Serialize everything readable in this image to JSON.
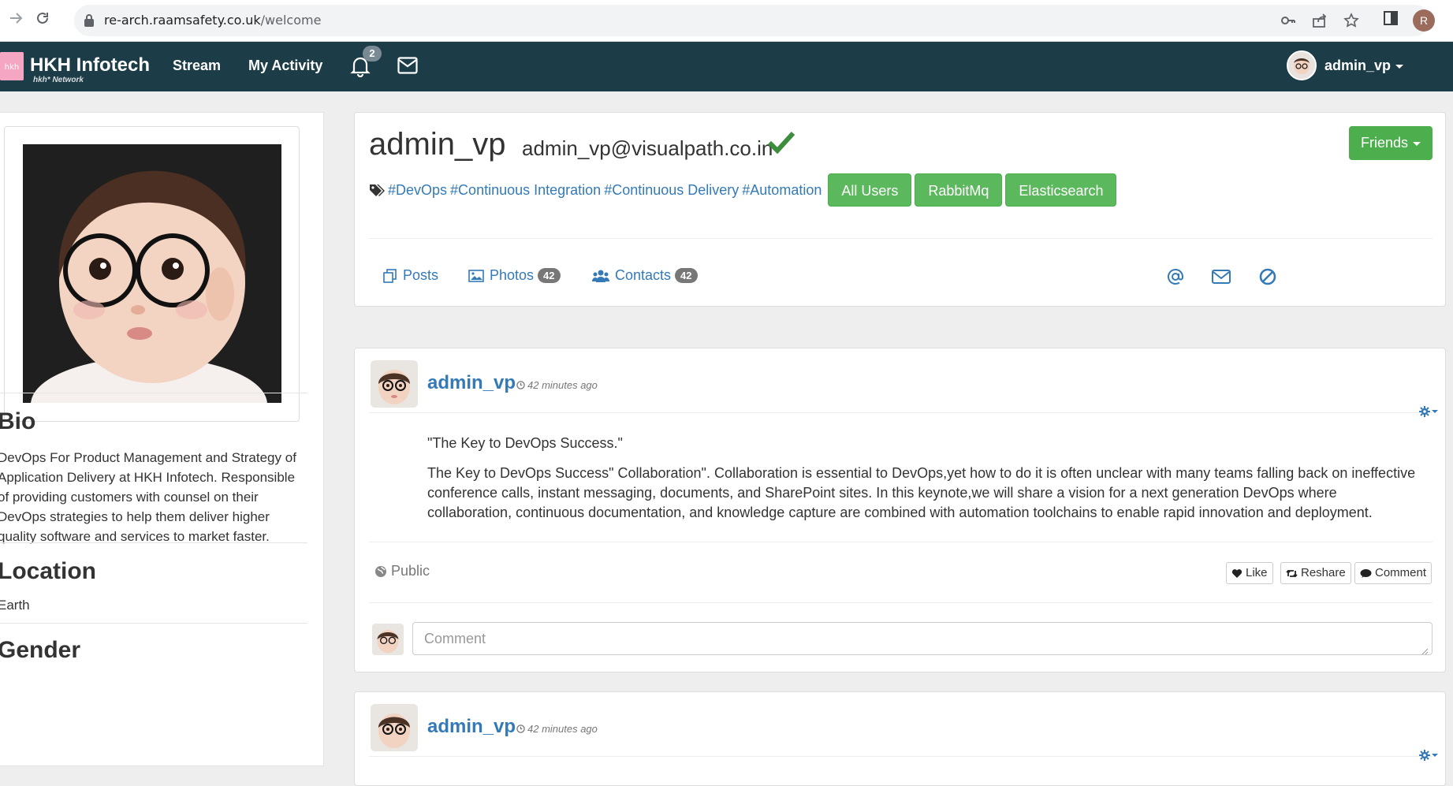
{
  "browser": {
    "url_host": "re-arch.raamsafety.co.uk",
    "url_path": "/welcome",
    "profile_initial": "R"
  },
  "navbar": {
    "brand_title": "HKH Infotech",
    "brand_subtitle": "hkh* Network",
    "logo_text": "hkh",
    "links": [
      "Stream",
      "My Activity"
    ],
    "notification_count": "2",
    "user_name": "admin_vp",
    "bg_color": "#1c3c48"
  },
  "sidebar": {
    "bio_heading": "Bio",
    "bio_text": "DevOps For Product Management and Strategy of Application Delivery at HKH Infotech. Responsible of providing customers with counsel on their DevOps strategies to help them deliver higher quality software and services to market faster.",
    "location_heading": "Location",
    "location_value": "Earth",
    "gender_heading": "Gender"
  },
  "profile": {
    "name": "admin_vp",
    "email": "admin_vp@visualpath.co.in",
    "friends_button": "Friends",
    "tags": [
      "#DevOps",
      "#Continuous Integration",
      "#Continuous Delivery",
      "#Automation"
    ],
    "group_buttons": [
      "All Users",
      "RabbitMq",
      "Elasticsearch"
    ],
    "tabs": [
      {
        "label": "Posts",
        "icon": "copy-icon"
      },
      {
        "label": "Photos",
        "count": "42",
        "icon": "picture-icon"
      },
      {
        "label": "Contacts",
        "count": "42",
        "icon": "users-icon"
      }
    ],
    "accent_color": "#337ab7",
    "success_color": "#5cb85c"
  },
  "posts": [
    {
      "author": "admin_vp",
      "time": "42 minutes ago",
      "title": "\"The Key to DevOps Success.\"",
      "body": "The Key to DevOps Success\" Collaboration\". Collaboration is essential to DevOps,yet how to do it is often unclear with many teams falling back on ineffective conference calls, instant messaging, documents, and SharePoint sites. In this keynote,we will share a vision for a next generation DevOps where collaboration, continuous documentation, and knowledge capture are combined with automation toolchains to enable rapid innovation and deployment.",
      "visibility": "Public",
      "actions": [
        "Like",
        "Reshare",
        "Comment"
      ],
      "comment_placeholder": "Comment"
    },
    {
      "author": "admin_vp",
      "time": "42 minutes ago"
    }
  ]
}
